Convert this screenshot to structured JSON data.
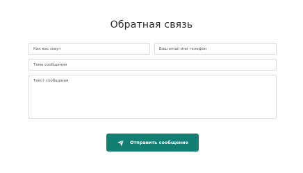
{
  "form": {
    "title": "Обратная связь",
    "name_placeholder": "Как вас зовут",
    "contact_placeholder": "Ваш email или телефон",
    "subject_placeholder": "Тема сообщения",
    "message_placeholder": "Текст сообщения",
    "submit_label": "Отправить сообщение",
    "submit_icon": "paper-plane-icon"
  },
  "colors": {
    "accent": "#137f72",
    "border": "#dcdcdc",
    "text": "#2b2b2b"
  }
}
